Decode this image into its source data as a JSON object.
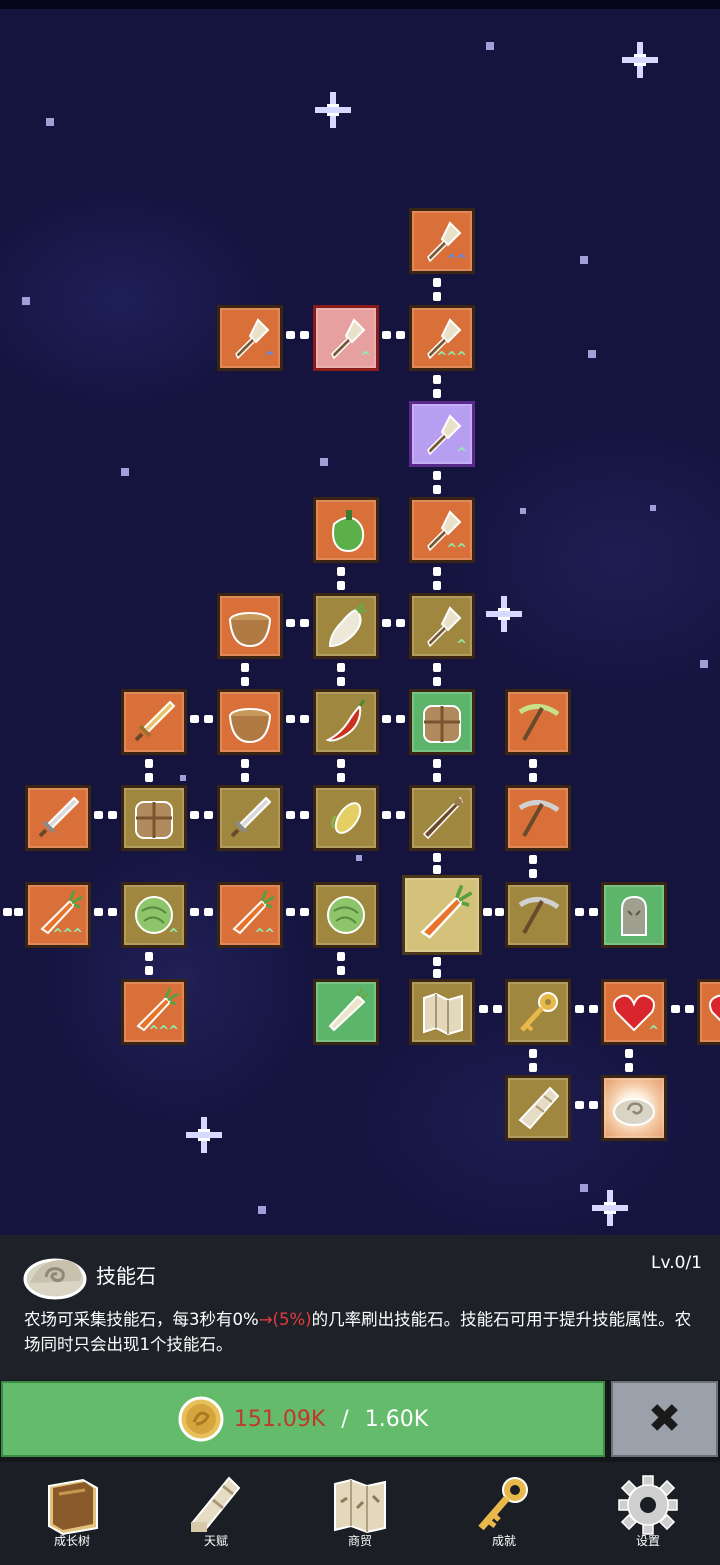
{
  "info": {
    "title": "技能石",
    "level": "Lv.0/1",
    "desc_before": "农场可采集技能石，每3秒有0%",
    "desc_highlight": "→(5%)",
    "desc_after": "的几率刷出技能石。技能石可用于提升技能属性。农场同时只会出现1个技能石。"
  },
  "cost": {
    "current": "151.09K",
    "separator": "/",
    "total": "1.60K"
  },
  "close_icon": "close-x-icon",
  "nav": [
    {
      "label": "成长树",
      "icon": "book-icon"
    },
    {
      "label": "天赋",
      "icon": "scroll-icon"
    },
    {
      "label": "商贸",
      "icon": "map-icon"
    },
    {
      "label": "成就",
      "icon": "key-icon"
    },
    {
      "label": "设置",
      "icon": "gear-icon"
    }
  ],
  "nodes": [
    {
      "name": "shovel-node",
      "icon": "shovel-icon",
      "color": "orange",
      "mark": "blue2"
    },
    {
      "name": "shovel-node",
      "icon": "shovel-icon",
      "color": "orange",
      "mark": "blue"
    },
    {
      "name": "shovel-node",
      "icon": "shovel-icon",
      "color": "red",
      "mark": "green"
    },
    {
      "name": "shovel-node",
      "icon": "shovel-icon",
      "color": "orange",
      "mark": "green3"
    },
    {
      "name": "shovel-node",
      "icon": "shovel-icon",
      "color": "purple",
      "mark": "green"
    },
    {
      "name": "pepper-node",
      "icon": "pepper-icon",
      "color": "orange",
      "mark": ""
    },
    {
      "name": "shovel-node",
      "icon": "shovel-icon",
      "color": "orange",
      "mark": "green2"
    },
    {
      "name": "bowl-node",
      "icon": "bowl-icon",
      "color": "orange",
      "mark": ""
    },
    {
      "name": "radish-node",
      "icon": "radish-icon",
      "color": "brown",
      "mark": ""
    },
    {
      "name": "shovel-node",
      "icon": "shovel-icon",
      "color": "brown",
      "mark": "green"
    },
    {
      "name": "sword-node",
      "icon": "sword-gold-icon",
      "color": "orange",
      "mark": ""
    },
    {
      "name": "bowl-node",
      "icon": "bowl-icon",
      "color": "orange",
      "mark": ""
    },
    {
      "name": "chili-node",
      "icon": "chili-icon",
      "color": "brown",
      "mark": ""
    },
    {
      "name": "backpack-node",
      "icon": "backpack-icon",
      "color": "green",
      "mark": ""
    },
    {
      "name": "pickaxe-node",
      "icon": "pickaxe-green-icon",
      "color": "orange",
      "mark": ""
    },
    {
      "name": "sword-node",
      "icon": "sword-icon",
      "color": "orange",
      "mark": ""
    },
    {
      "name": "backpack-node",
      "icon": "backpack-icon",
      "color": "brown",
      "mark": ""
    },
    {
      "name": "sword-node",
      "icon": "sword-icon",
      "color": "brown",
      "mark": ""
    },
    {
      "name": "corn-node",
      "icon": "corn-icon",
      "color": "brown",
      "mark": ""
    },
    {
      "name": "staff-node",
      "icon": "staff-icon",
      "color": "brown",
      "mark": ""
    },
    {
      "name": "pickaxe-node",
      "icon": "pickaxe-icon",
      "color": "orange",
      "mark": ""
    },
    {
      "name": "carrot-node",
      "icon": "carrot-icon",
      "color": "orange",
      "mark": "green3"
    },
    {
      "name": "cabbage-node",
      "icon": "cabbage-icon",
      "color": "brown",
      "mark": "green"
    },
    {
      "name": "carrot-node",
      "icon": "carrot-icon",
      "color": "orange",
      "mark": "green2"
    },
    {
      "name": "cabbage-node",
      "icon": "cabbage-icon",
      "color": "brown",
      "mark": ""
    },
    {
      "name": "carrot-node",
      "icon": "carrot-icon",
      "color": "big",
      "mark": ""
    },
    {
      "name": "pickaxe-node",
      "icon": "pickaxe-icon",
      "color": "brown",
      "mark": ""
    },
    {
      "name": "ghost-node",
      "icon": "ghost-icon",
      "color": "green",
      "mark": ""
    },
    {
      "name": "carrot-node",
      "icon": "carrot-icon",
      "color": "orange",
      "mark": "green3"
    },
    {
      "name": "radish-node",
      "icon": "parsnip-icon",
      "color": "green",
      "mark": ""
    },
    {
      "name": "map-node",
      "icon": "map-icon",
      "color": "brown",
      "mark": ""
    },
    {
      "name": "key-node",
      "icon": "key-icon",
      "color": "brown",
      "mark": ""
    },
    {
      "name": "heart-node",
      "icon": "heart-icon",
      "color": "orange",
      "mark": "green"
    },
    {
      "name": "partial-node",
      "icon": "heart-icon",
      "color": "orange",
      "mark": ""
    },
    {
      "name": "scroll-node",
      "icon": "scroll-icon",
      "color": "brown",
      "mark": ""
    },
    {
      "name": "skill-stone-node",
      "icon": "stone-icon",
      "color": "glow",
      "mark": ""
    }
  ]
}
